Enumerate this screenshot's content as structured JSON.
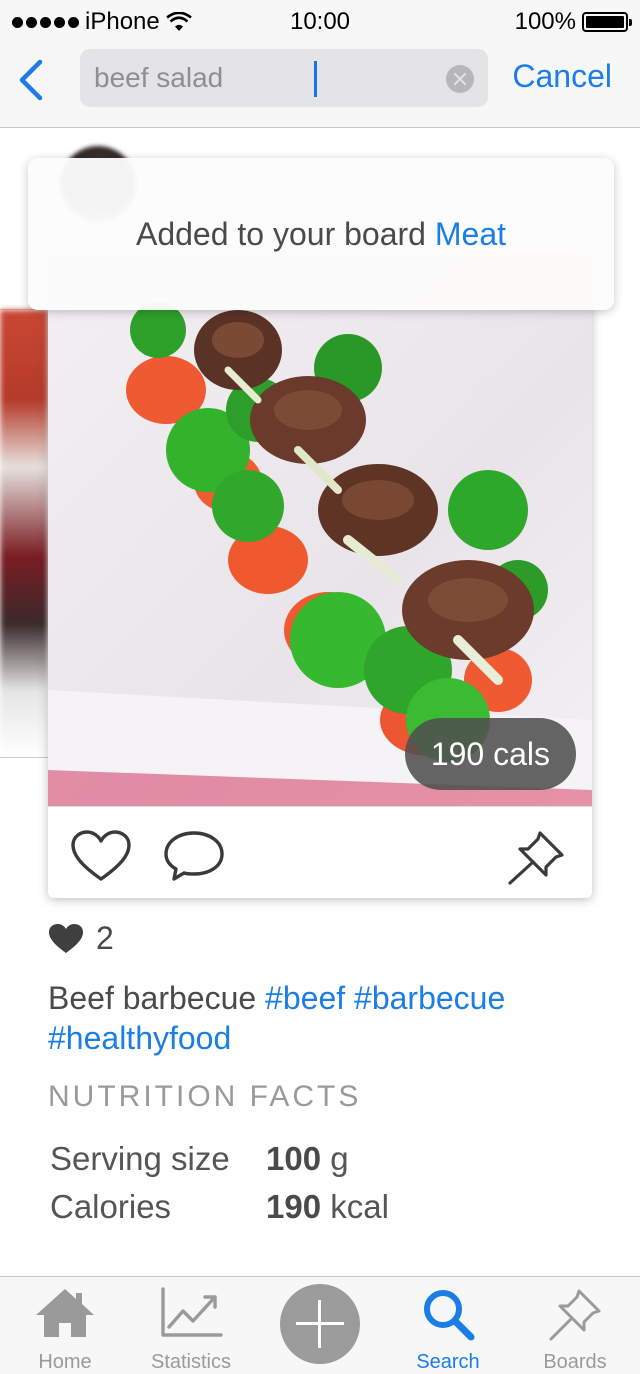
{
  "status_bar": {
    "carrier": "iPhone",
    "time": "10:00",
    "battery": "100%",
    "battery_level": 1.0
  },
  "search": {
    "query": "beef salad",
    "cancel_label": "Cancel"
  },
  "toast": {
    "prefix": "Added to your board ",
    "board_name": "Meat"
  },
  "post": {
    "calories_badge": "190 cals",
    "likes_count": "2",
    "caption_text": "Beef barbecue ",
    "hashtags": [
      "#beef",
      "#barbecue",
      "#healthyfood"
    ]
  },
  "nutrition": {
    "title": "NUTRITION FACTS",
    "rows": [
      {
        "label": "Serving size",
        "value": "100",
        "unit": "g"
      },
      {
        "label": "Calories",
        "value": "190",
        "unit": "kcal"
      }
    ]
  },
  "tabbar": {
    "items": [
      {
        "label": "Home",
        "icon": "home-icon",
        "active": false
      },
      {
        "label": "Statistics",
        "icon": "statistics-icon",
        "active": false
      },
      {
        "label": "",
        "icon": "plus-icon",
        "active": false
      },
      {
        "label": "Search",
        "icon": "search-icon",
        "active": true
      },
      {
        "label": "Boards",
        "icon": "pin-icon",
        "active": false
      }
    ]
  },
  "colors": {
    "accent": "#1a7ee6",
    "inactive": "#9a9a9a",
    "text": "#4a4a4a"
  }
}
